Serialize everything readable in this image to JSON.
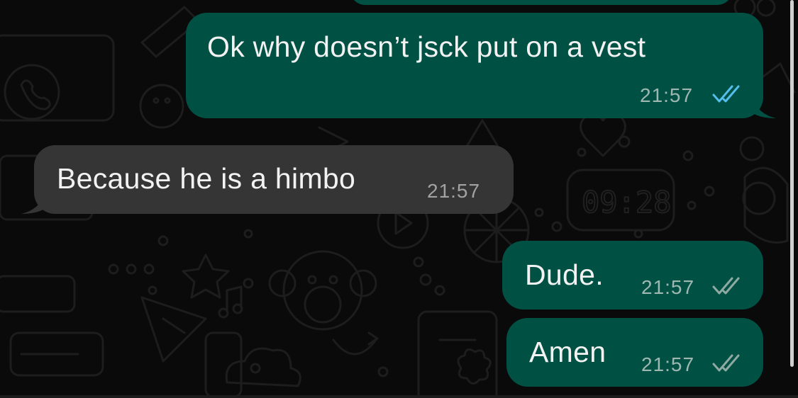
{
  "messages": [
    {
      "direction": "outgoing",
      "text": "Ok why doesn’t jsck put on a vest",
      "time": "21:57",
      "status": "read",
      "status_icon": "double-check-icon",
      "status_color": "#53bdeb"
    },
    {
      "direction": "incoming",
      "text": "Because he is a himbo",
      "time": "21:57"
    },
    {
      "direction": "outgoing",
      "text": "Dude.",
      "time": "21:57",
      "status": "delivered",
      "status_icon": "double-check-icon",
      "status_color": "#8fa9a3"
    },
    {
      "direction": "outgoing",
      "text": "Amen",
      "time": "21:57",
      "status": "delivered",
      "status_icon": "double-check-icon",
      "status_color": "#8fa9a3"
    }
  ],
  "wallpaper_clock": "09:28",
  "colors": {
    "outgoing_bubble": "#005144",
    "incoming_bubble": "#353535",
    "background": "#0a0a0a",
    "read_ticks": "#53bdeb",
    "delivered_ticks": "#8fa9a3"
  }
}
